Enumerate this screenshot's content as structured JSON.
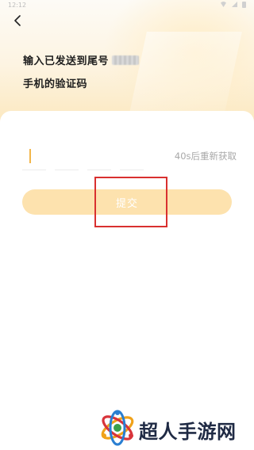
{
  "status_bar": {
    "time": "12:12"
  },
  "header": {
    "title_line1": "输入已发送到尾号",
    "title_line2": "手机的验证码"
  },
  "verification": {
    "code_digits": [
      "",
      "",
      "",
      ""
    ],
    "resend_label": "40s后重新获取"
  },
  "actions": {
    "submit_label": "提交"
  },
  "colors": {
    "accent": "#f2b64a",
    "submit_bg": "#fde2ae",
    "highlight": "#d9302f"
  },
  "watermark": {
    "text": "超人手游网"
  }
}
